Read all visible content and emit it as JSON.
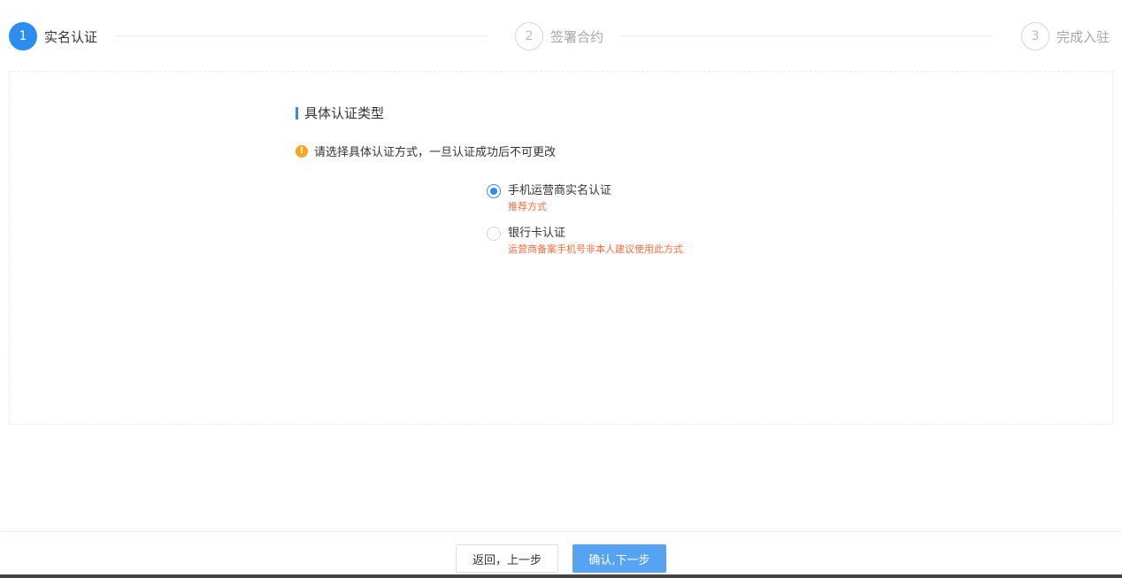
{
  "steps": [
    {
      "number": "1",
      "label": "实名认证",
      "state": "active"
    },
    {
      "number": "2",
      "label": "签署合约",
      "state": "inactive"
    },
    {
      "number": "3",
      "label": "完成入驻",
      "state": "inactive"
    }
  ],
  "section": {
    "title": "具体认证类型",
    "notice": "请选择具体认证方式，一旦认证成功后不可更改",
    "notice_icon": "warning-icon"
  },
  "options": [
    {
      "label": "手机运营商实名认证",
      "sub": "推荐方式",
      "checked": true
    },
    {
      "label": "银行卡认证",
      "sub": "运营商备案手机号非本人建议使用此方式",
      "checked": false
    }
  ],
  "footer": {
    "back_label": "返回，上一步",
    "next_label": "确认,下一步"
  },
  "colors": {
    "primary": "#2d8cf0",
    "button_primary": "#57a3f3",
    "warning": "#f5a623",
    "sub_text": "#ff6a3d"
  }
}
